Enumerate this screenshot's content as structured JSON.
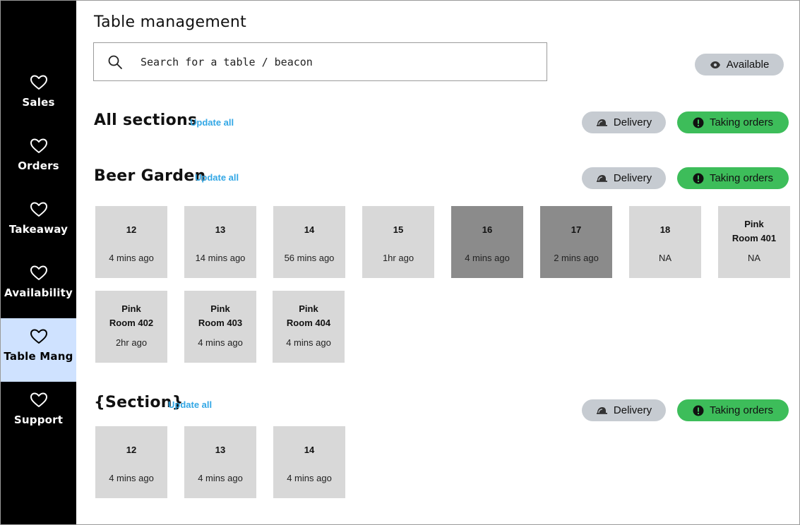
{
  "sidebar": {
    "items": [
      {
        "label": "Sales",
        "icon": "heart-icon"
      },
      {
        "label": "Orders",
        "icon": "heart-icon"
      },
      {
        "label": "Takeaway",
        "icon": "heart-icon"
      },
      {
        "label": "Availability",
        "icon": "heart-icon"
      },
      {
        "label": "Table Mang",
        "icon": "heart-icon",
        "active": true
      },
      {
        "label": "Support",
        "icon": "heart-icon"
      }
    ]
  },
  "page": {
    "title": "Table management",
    "search_placeholder": "Search for a table / beacon",
    "available_label": "Available"
  },
  "colors": {
    "sidebar": "#000000",
    "active_nav": "#cfe2ff",
    "pill_grey": "#c6cbd1",
    "pill_green": "#3dbd5a",
    "link": "#32a7e5",
    "tile": "#d8d8d8",
    "tile_dark": "#8b8b8b"
  },
  "sections": [
    {
      "title": "All sections",
      "update_label": "Update all",
      "delivery_label": "Delivery",
      "taking_label": "Taking orders",
      "tables": []
    },
    {
      "title": "Beer Garden",
      "update_label": "Update all",
      "delivery_label": "Delivery",
      "taking_label": "Taking orders",
      "tables": [
        {
          "line1": "12",
          "time": "4 mins ago"
        },
        {
          "line1": "13",
          "time": "14 mins ago"
        },
        {
          "line1": "14",
          "time": "56 mins ago"
        },
        {
          "line1": "15",
          "time": "1hr ago"
        },
        {
          "line1": "16",
          "time": "4 mins ago",
          "dark": true
        },
        {
          "line1": "17",
          "time": "2 mins ago",
          "dark": true
        },
        {
          "line1": "18",
          "time": "NA"
        },
        {
          "line1": "Pink",
          "line2": "Room 401",
          "time": "NA"
        },
        {
          "line1": "Pink",
          "line2": "Room 402",
          "time": "2hr ago"
        },
        {
          "line1": "Pink",
          "line2": "Room 403",
          "time": "4 mins ago"
        },
        {
          "line1": "Pink",
          "line2": "Room 404",
          "time": "4 mins ago"
        }
      ]
    },
    {
      "title": "{Section}",
      "update_label": "Update all",
      "delivery_label": "Delivery",
      "taking_label": "Taking orders",
      "tables": [
        {
          "line1": "12",
          "time": "4 mins ago"
        },
        {
          "line1": "13",
          "time": "4 mins ago"
        },
        {
          "line1": "14",
          "time": "4 mins ago"
        }
      ]
    }
  ]
}
